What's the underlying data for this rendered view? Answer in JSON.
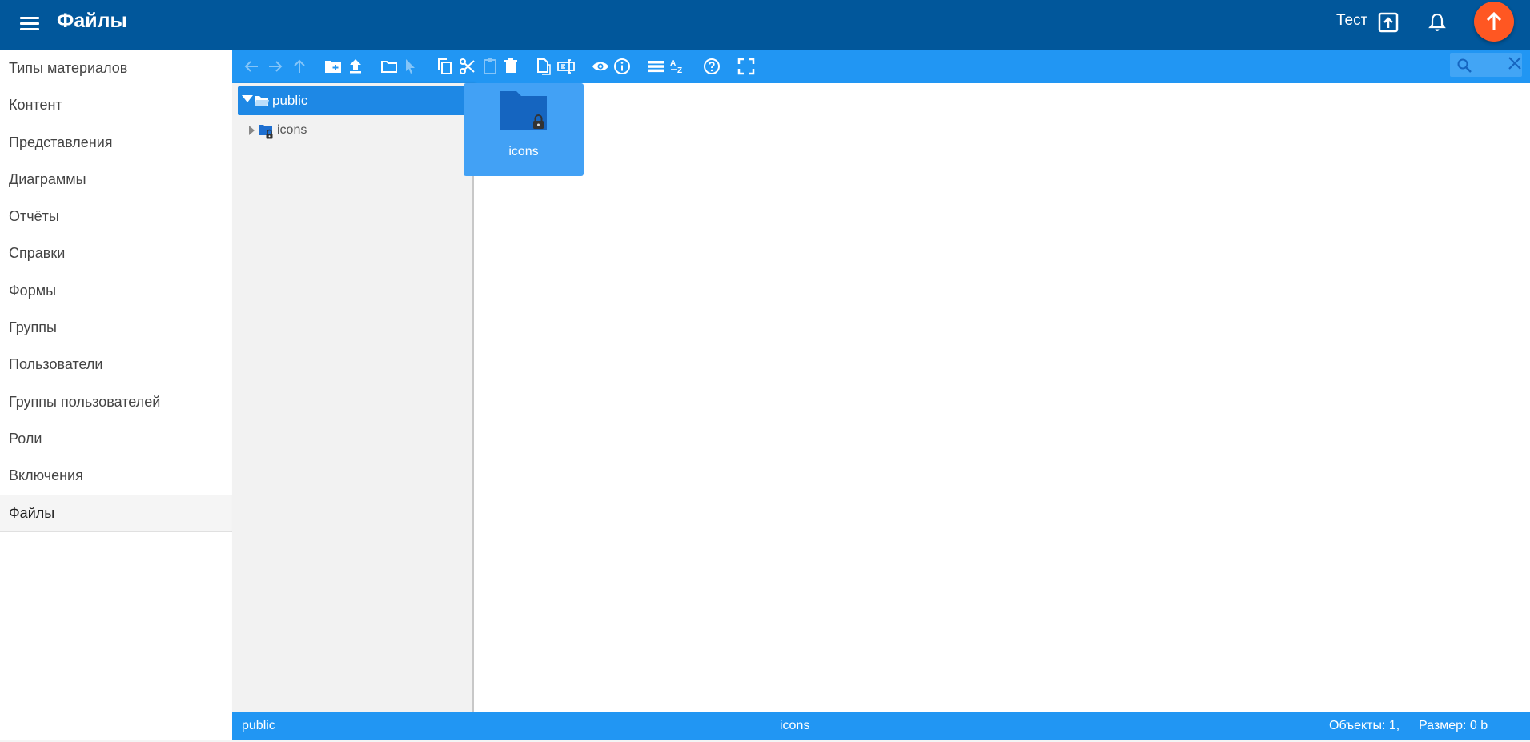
{
  "header": {
    "title": "Файлы",
    "user_name": "Тест",
    "colors": {
      "appbar": "#01579b",
      "fab": "#ff5722"
    }
  },
  "sidebar": {
    "items": [
      {
        "label": "Типы материалов"
      },
      {
        "label": "Контент"
      },
      {
        "label": "Представления"
      },
      {
        "label": "Диаграммы"
      },
      {
        "label": "Отчёты"
      },
      {
        "label": "Справки"
      },
      {
        "label": "Формы"
      },
      {
        "label": "Группы"
      },
      {
        "label": "Пользователи"
      },
      {
        "label": "Группы пользователей"
      },
      {
        "label": "Роли"
      },
      {
        "label": "Включения"
      },
      {
        "label": "Файлы",
        "active": true
      }
    ]
  },
  "file_manager": {
    "toolbar": {
      "color": "#2196f3",
      "buttons": [
        "back-icon",
        "forward-icon",
        "up-icon",
        "new-folder-icon",
        "upload-icon",
        "open-folder-icon",
        "select-icon",
        "copy-icon",
        "cut-icon",
        "paste-icon",
        "delete-icon",
        "duplicate-icon",
        "rename-icon",
        "preview-icon",
        "info-icon",
        "list-view-icon",
        "sort-icon",
        "help-icon",
        "fullscreen-icon"
      ]
    },
    "tree": {
      "root": "public",
      "children": [
        {
          "label": "icons",
          "locked": true
        }
      ]
    },
    "content": {
      "items": [
        {
          "label": "icons",
          "type": "folder",
          "locked": true,
          "selected": true
        }
      ]
    },
    "status": {
      "path": "public",
      "selected": "icons",
      "count": "Объекты: 1,",
      "size": "Размер: 0 b"
    }
  }
}
